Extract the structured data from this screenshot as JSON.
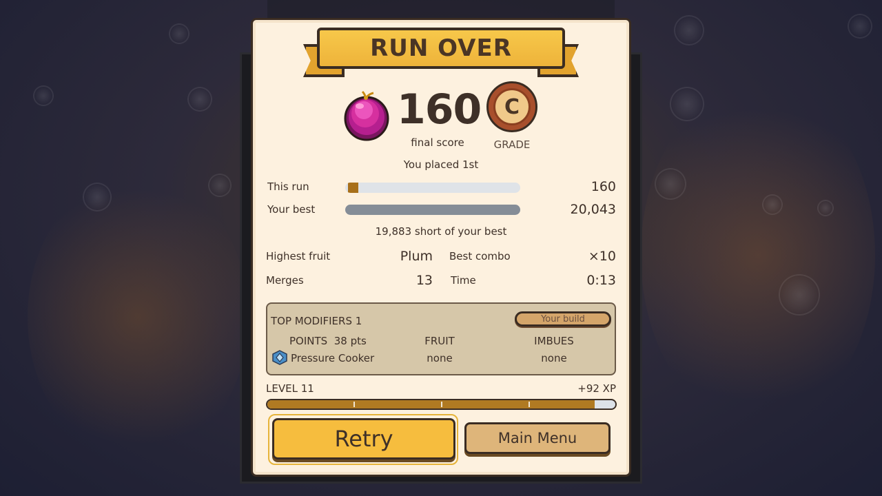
{
  "title": "RUN OVER",
  "score": {
    "value": "160",
    "label": "final score",
    "fruit_icon": "plum-icon"
  },
  "grade": {
    "letter": "C",
    "label": "GRADE"
  },
  "placement": "You placed 1st",
  "progress": {
    "this_run": {
      "label": "This run",
      "value": "160",
      "fraction": 0.008
    },
    "your_best": {
      "label": "Your best",
      "value": "20,043",
      "fraction": 1.0
    },
    "short_text": "19,883 short of your best"
  },
  "stats": {
    "highest_fruit_label": "Highest fruit",
    "highest_fruit_value": "Plum",
    "best_combo_label": "Best combo",
    "best_combo_value": "×10",
    "merges_label": "Merges",
    "merges_value": "13",
    "time_label": "Time",
    "time_value": "0:13"
  },
  "modifiers": {
    "title": "TOP MODIFIERS",
    "count": "1",
    "build_button": "Your build",
    "points_header": "POINTS",
    "points_value": "38 pts",
    "fruit_header": "FRUIT",
    "imbues_header": "IMBUES",
    "modifier_name": "Pressure Cooker",
    "modifier_icon": "diamond-icon",
    "fruit_value": "none",
    "imbues_value": "none"
  },
  "level": {
    "label": "LEVEL 11",
    "xp_gain": "+92 XP",
    "fraction": 0.94
  },
  "buttons": {
    "retry": "Retry",
    "main_menu": "Main Menu"
  },
  "colors": {
    "panel": "#fdf1df",
    "accent_gold": "#f6bd3e",
    "this_run_fill": "#a8701a",
    "best_fill": "#858d97",
    "xp_fill": "#b07a22"
  }
}
